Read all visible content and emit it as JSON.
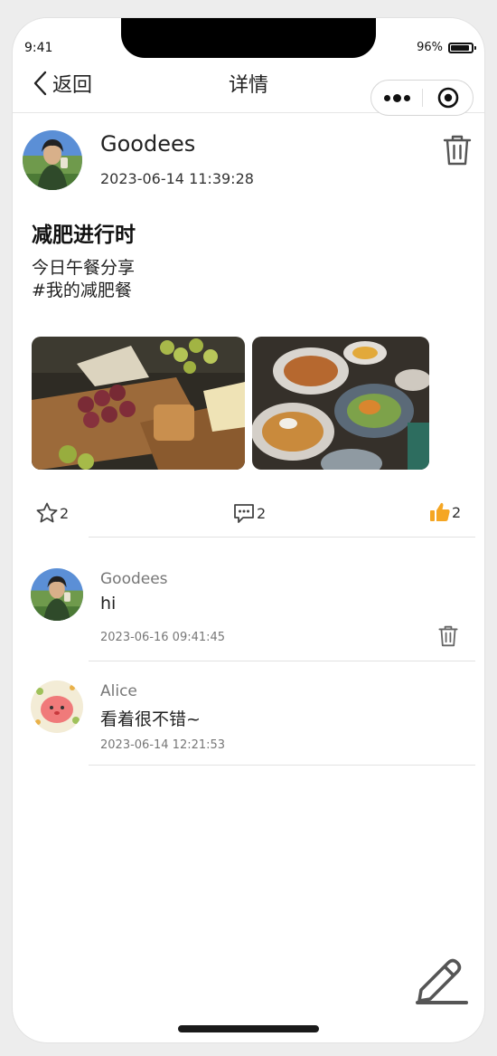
{
  "status_bar": {
    "time": "9:41",
    "battery": "96%"
  },
  "nav": {
    "back_label": "返回",
    "title": "详情"
  },
  "post": {
    "author": "Goodees",
    "time": "2023-06-14 11:39:28",
    "title": "减肥进行时",
    "content_lines": [
      "今日午餐分享",
      "#我的减肥餐"
    ]
  },
  "actions": {
    "favorites": "2",
    "comments": "2",
    "likes": "2"
  },
  "comments": [
    {
      "name": "Goodees",
      "text": "hi",
      "time": "2023-06-16 09:41:45"
    },
    {
      "name": "Alice",
      "text": "看着很不错~",
      "time": "2023-06-14 12:21:53"
    }
  ],
  "colors": {
    "like_accent": "#f5a623",
    "icon_gray": "#555555",
    "divider": "#e2e2e2"
  }
}
